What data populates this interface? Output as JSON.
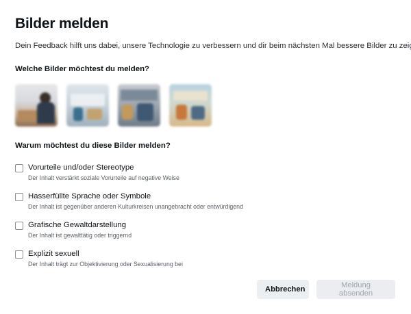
{
  "dialog": {
    "title": "Bilder melden",
    "subtitle": "Dein Feedback hilft uns dabei, unsere Technologie zu verbessern und dir beim nächsten Mal bessere Bilder zu zeigen.",
    "images_question": "Welche Bilder möchtest du melden?",
    "reason_question": "Warum möchtest du diese Bilder melden?",
    "options": [
      {
        "label": "Vorurteile und/oder Stereotype",
        "description": "Der Inhalt verstärkt soziale Vorurteile auf negative Weise",
        "checked": false
      },
      {
        "label": "Hasserfüllte Sprache oder Symbole",
        "description": "Der Inhalt ist gegenüber anderen Kulturkreisen unangebracht oder entwürdigend",
        "checked": false
      },
      {
        "label": "Grafische Gewaltdarstellung",
        "description": "Der Inhalt ist gewalttätig oder triggernd",
        "checked": false
      },
      {
        "label": "Explizit sexuell",
        "description": "Der Inhalt trägt zur Objektivierung oder Sexualisierung bei",
        "checked": false
      }
    ],
    "buttons": {
      "cancel": "Abbrechen",
      "submit": "Meldung absenden"
    }
  }
}
